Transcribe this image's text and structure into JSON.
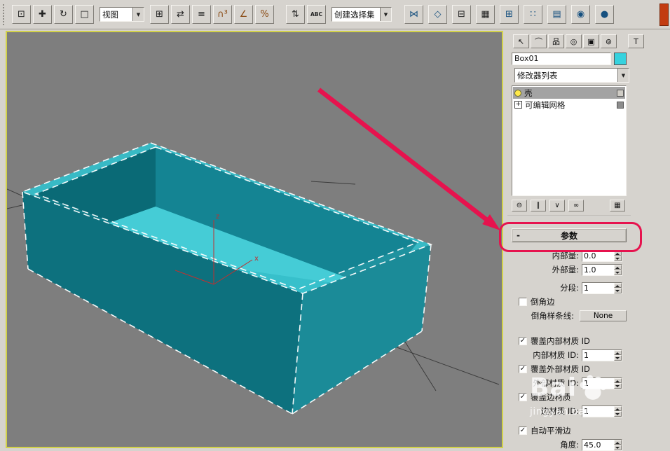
{
  "app": {
    "accent_red": "#e6134e",
    "bg": "#d6d3ce"
  },
  "glyphs": {
    "dropdown_arrow": "▼",
    "plus": "+",
    "check": "✓"
  },
  "toolbar": {
    "view_combo": {
      "value": "视图"
    },
    "selection_combo": {
      "value": "创建选择集"
    },
    "groups": {
      "left": [
        {
          "name": "select-object-icon",
          "glyph": "⊡"
        },
        {
          "name": "select-and-move-icon",
          "glyph": "✚"
        },
        {
          "name": "select-and-rotate-icon",
          "glyph": "↻"
        },
        {
          "name": "select-and-scale-icon",
          "glyph": "□"
        }
      ],
      "mid": [
        {
          "name": "use-center-icon",
          "glyph": "⊞"
        },
        {
          "name": "mirror-selected-icon",
          "glyph": "⇄"
        },
        {
          "name": "layers-icon",
          "glyph": "≡"
        },
        {
          "name": "snap-3d-icon",
          "glyph": "∩³",
          "tint": "#8a4a12"
        },
        {
          "name": "angle-snap-icon",
          "glyph": "∠",
          "tint": "#8a4a12"
        },
        {
          "name": "percent-snap-icon",
          "glyph": "%",
          "tint": "#8a4a12"
        },
        {
          "name": "spinner-snap-icon",
          "glyph": "⇅",
          "gap": true
        },
        {
          "name": "edit-named-selection-icon",
          "glyph": "ABC"
        }
      ],
      "right": [
        {
          "name": "mirror-tool-icon",
          "glyph": "⋈",
          "tint": "#16507f"
        },
        {
          "name": "align-icon",
          "glyph": "◇",
          "tint": "#16507f"
        },
        {
          "name": "layer-manager-icon",
          "glyph": "⊟"
        },
        {
          "name": "curve-editor-icon",
          "glyph": "▦"
        },
        {
          "name": "schematic-view-icon",
          "glyph": "⊞",
          "tint": "#16507f"
        },
        {
          "name": "material-editor-icon",
          "glyph": "∷",
          "tint": "#16507f"
        },
        {
          "name": "render-setup-icon",
          "glyph": "▤",
          "tint": "#16507f"
        },
        {
          "name": "render-frame-icon",
          "glyph": "◉",
          "tint": "#16507f"
        },
        {
          "name": "render-icon",
          "glyph": "●",
          "tint": "#16507f"
        }
      ]
    }
  },
  "viewport": {
    "bg": "#7e7e7e",
    "border": "#d2d24b",
    "grid_color": "#3c3c3c",
    "box": {
      "rim": "#38bac5",
      "inner_left": "#0a6a76",
      "inner_right": "#148493",
      "inner_front_left": "#0f7b88",
      "inner_front_right": "#1f929f",
      "floor_light": "#45ccd6",
      "floor_dark": "#37c0cb",
      "outer_left": "#0d717e",
      "outer_right": "#1b8b98",
      "edge": "#ffffff"
    },
    "axis": {
      "color": "#c03030",
      "z_label": "z",
      "x_label": "x"
    }
  },
  "command_panel": {
    "tabs": [
      {
        "name": "create-tab",
        "glyph": "↖"
      },
      {
        "name": "modify-tab",
        "glyph": "⌒"
      },
      {
        "name": "hierarchy-tab",
        "glyph": "品"
      },
      {
        "name": "motion-tab",
        "glyph": "◎"
      },
      {
        "name": "display-tab",
        "glyph": "▣"
      },
      {
        "name": "utilities-tab",
        "glyph": "⊚"
      },
      {
        "name": "utilities-hammer-icon",
        "glyph": "T",
        "gap": true
      }
    ],
    "object_name": "Box01",
    "object_color": "#36d2de",
    "modifier_list_label": "修改器列表",
    "stack": [
      {
        "label": "壳",
        "selected": true
      },
      {
        "label": "可编辑网格",
        "selected": false
      }
    ],
    "stack_tools": [
      {
        "name": "pin-stack-icon",
        "glyph": "⊖"
      },
      {
        "name": "show-end-result-icon",
        "glyph": "∥"
      },
      {
        "name": "make-unique-icon",
        "glyph": "∨"
      },
      {
        "name": "remove-modifier-icon",
        "glyph": "∞"
      },
      {
        "name": "configure-modifier-sets-icon",
        "glyph": "▦",
        "right": true
      }
    ],
    "rollout": {
      "collapse": "-",
      "label": "参数"
    },
    "params": {
      "inner_amount": {
        "label": "内部量:",
        "value": "0.0"
      },
      "outer_amount": {
        "label": "外部量:",
        "value": "1.0"
      },
      "segments": {
        "label": "分段:",
        "value": "1"
      },
      "bevel_edges": {
        "label": "倒角边",
        "mark": ""
      },
      "bevel_spline": {
        "label": "倒角样条线:",
        "button": "None"
      },
      "override_inner": {
        "label": "覆盖内部材质 ID",
        "mark": "✓"
      },
      "inner_mat_id": {
        "label": "内部材质 ID:",
        "value": "1"
      },
      "override_outer": {
        "label": "覆盖外部材质 ID",
        "mark": "✓"
      },
      "outer_mat_id": {
        "label": "外部材质 ID:",
        "value": "1"
      },
      "override_edge": {
        "label": "覆盖边材质",
        "mark": "✓"
      },
      "edge_mat_id": {
        "label": "边材质 ID:",
        "value": "1"
      },
      "auto_smooth": {
        "label": "自动平滑边",
        "mark": "✓"
      },
      "angle": {
        "label": "角度:",
        "value": "45.0"
      }
    }
  },
  "watermark": {
    "brand": "Bai",
    "url": "jingyan.baidu..."
  }
}
